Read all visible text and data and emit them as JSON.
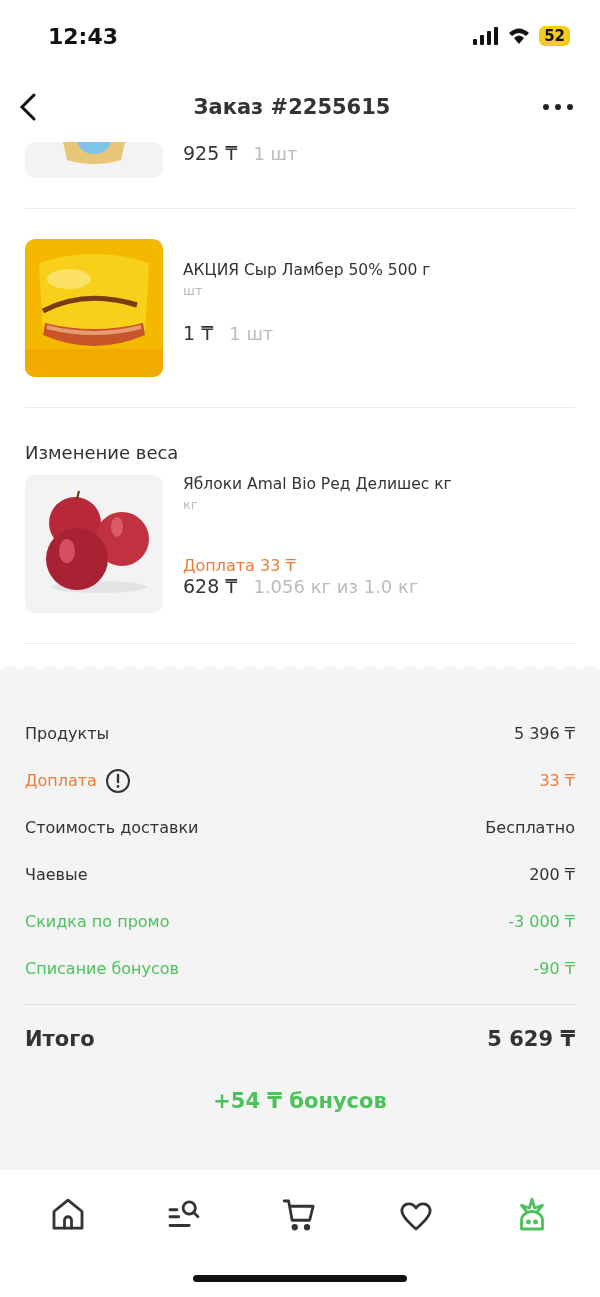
{
  "status_bar": {
    "time": "12:43",
    "battery": "52"
  },
  "header": {
    "title": "Заказ #2255615"
  },
  "items": [
    {
      "kind": "partial",
      "price": "925 ₸",
      "quantity": "1 шт"
    },
    {
      "kind": "cheese",
      "name": "АКЦИЯ Сыр Ламбер 50% 500 г",
      "unit": "шт",
      "price": "1 ₸",
      "quantity": "1 шт"
    }
  ],
  "weight_change": {
    "title": "Изменение веса",
    "items": [
      {
        "kind": "apples",
        "name": "Яблоки Amal Bio Ред Делишес кг",
        "unit": "кг",
        "surcharge": "Доплата 33 ₸",
        "price": "628 ₸",
        "quantity": "1.056 кг из 1.0 кг"
      }
    ]
  },
  "summary": {
    "rows": [
      {
        "label": "Продукты",
        "value": "5 396 ₸",
        "color": "#333333",
        "info": false
      },
      {
        "label": "Доплата",
        "value": "33 ₸",
        "color": "#ee7b36",
        "info": true
      },
      {
        "label": "Стоимость доставки",
        "value": "Бесплатно",
        "color": "#333333",
        "info": false
      },
      {
        "label": "Чаевые",
        "value": "200 ₸",
        "color": "#333333",
        "info": false
      },
      {
        "label": "Скидка по промо",
        "value": "-3 000 ₸",
        "color": "#4cc25a",
        "info": false
      },
      {
        "label": "Списание бонусов",
        "value": "-90 ₸",
        "color": "#4cc25a",
        "info": false
      }
    ],
    "total_label": "Итого",
    "total_value": "5 629 ₸",
    "bonus": "+54 ₸ бонусов"
  },
  "nav": [
    {
      "kind": "home",
      "selected": false
    },
    {
      "kind": "catalog",
      "selected": false
    },
    {
      "kind": "cart",
      "selected": false
    },
    {
      "kind": "favorites",
      "selected": false
    },
    {
      "kind": "profile",
      "selected": true
    }
  ]
}
